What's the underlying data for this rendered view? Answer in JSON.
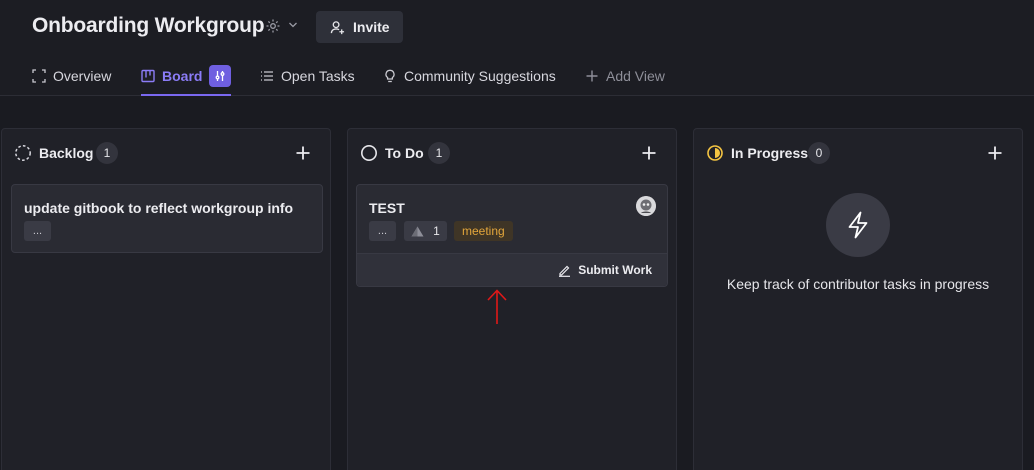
{
  "header": {
    "workgroup_title": "Onboarding Workgroup",
    "invite_label": "Invite"
  },
  "tabs": [
    {
      "label": "Overview",
      "icon": "overview-icon"
    },
    {
      "label": "Board",
      "icon": "board-icon",
      "active": true
    },
    {
      "label": "Open Tasks",
      "icon": "list-icon"
    },
    {
      "label": "Community Suggestions",
      "icon": "lightbulb-icon"
    },
    {
      "label": "Add View",
      "icon": "plus-icon"
    }
  ],
  "columns": [
    {
      "title": "Backlog",
      "count": "1",
      "cards": [
        {
          "title": "update gitbook to reflect workgroup info",
          "menu": "..."
        }
      ]
    },
    {
      "title": "To Do",
      "count": "1",
      "cards": [
        {
          "title": "TEST",
          "menu": "...",
          "points": "1",
          "tag": "meeting",
          "action": "Submit Work"
        }
      ]
    },
    {
      "title": "In Progress",
      "count": "0",
      "empty_text": "Keep track of contributor tasks in progress"
    }
  ],
  "colors": {
    "accent": "#7a68f0",
    "background": "#1a1b21",
    "column": "#202128",
    "card": "#2a2b33",
    "tag_text": "#e3a63b",
    "in_progress": "#f5c542",
    "annotation_arrow": "#e01818"
  }
}
